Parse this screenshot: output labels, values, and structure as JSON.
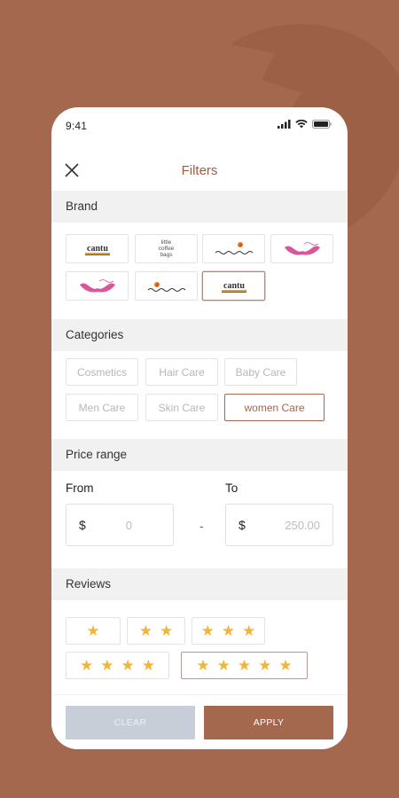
{
  "status": {
    "time": "9:41"
  },
  "nav": {
    "title": "Filters"
  },
  "sections": {
    "brand": "Brand",
    "categories": "Categories",
    "price": "Price range",
    "reviews": "Reviews"
  },
  "brands": [
    {
      "name": "cantu",
      "selected": false
    },
    {
      "name": "little coffee bags",
      "selected": false
    },
    {
      "name": "Jardim Botânico",
      "selected": false
    },
    {
      "name": "Hello Kitty",
      "selected": false
    },
    {
      "name": "Hello Kitty",
      "selected": false
    },
    {
      "name": "Jardim Botânico",
      "selected": false
    },
    {
      "name": "cantu",
      "selected": true
    }
  ],
  "brand_text": {
    "cantu": "cantu",
    "little_coffee": [
      "little",
      "coffee",
      "bags"
    ]
  },
  "categories": [
    {
      "label": "Cosmetics",
      "selected": false
    },
    {
      "label": "Hair Care",
      "selected": false
    },
    {
      "label": "Baby Care",
      "selected": false
    },
    {
      "label": "Men Care",
      "selected": false
    },
    {
      "label": "Skin Care",
      "selected": false
    },
    {
      "label": "women Care",
      "selected": true
    }
  ],
  "price": {
    "from_label": "From",
    "to_label": "To",
    "currency": "$",
    "from_value": "0",
    "to_value": "250.00",
    "separator": "-"
  },
  "reviews": [
    {
      "stars": 1,
      "selected": false
    },
    {
      "stars": 2,
      "selected": false
    },
    {
      "stars": 3,
      "selected": false
    },
    {
      "stars": 4,
      "selected": false
    },
    {
      "stars": 5,
      "selected": true
    }
  ],
  "buttons": {
    "clear": "CLEAR",
    "apply": "APPLY"
  },
  "colors": {
    "accent": "#a3684e",
    "star": "#f3b43a",
    "clear_button": "#c8ced8",
    "section_bg": "#f1f1f1"
  }
}
